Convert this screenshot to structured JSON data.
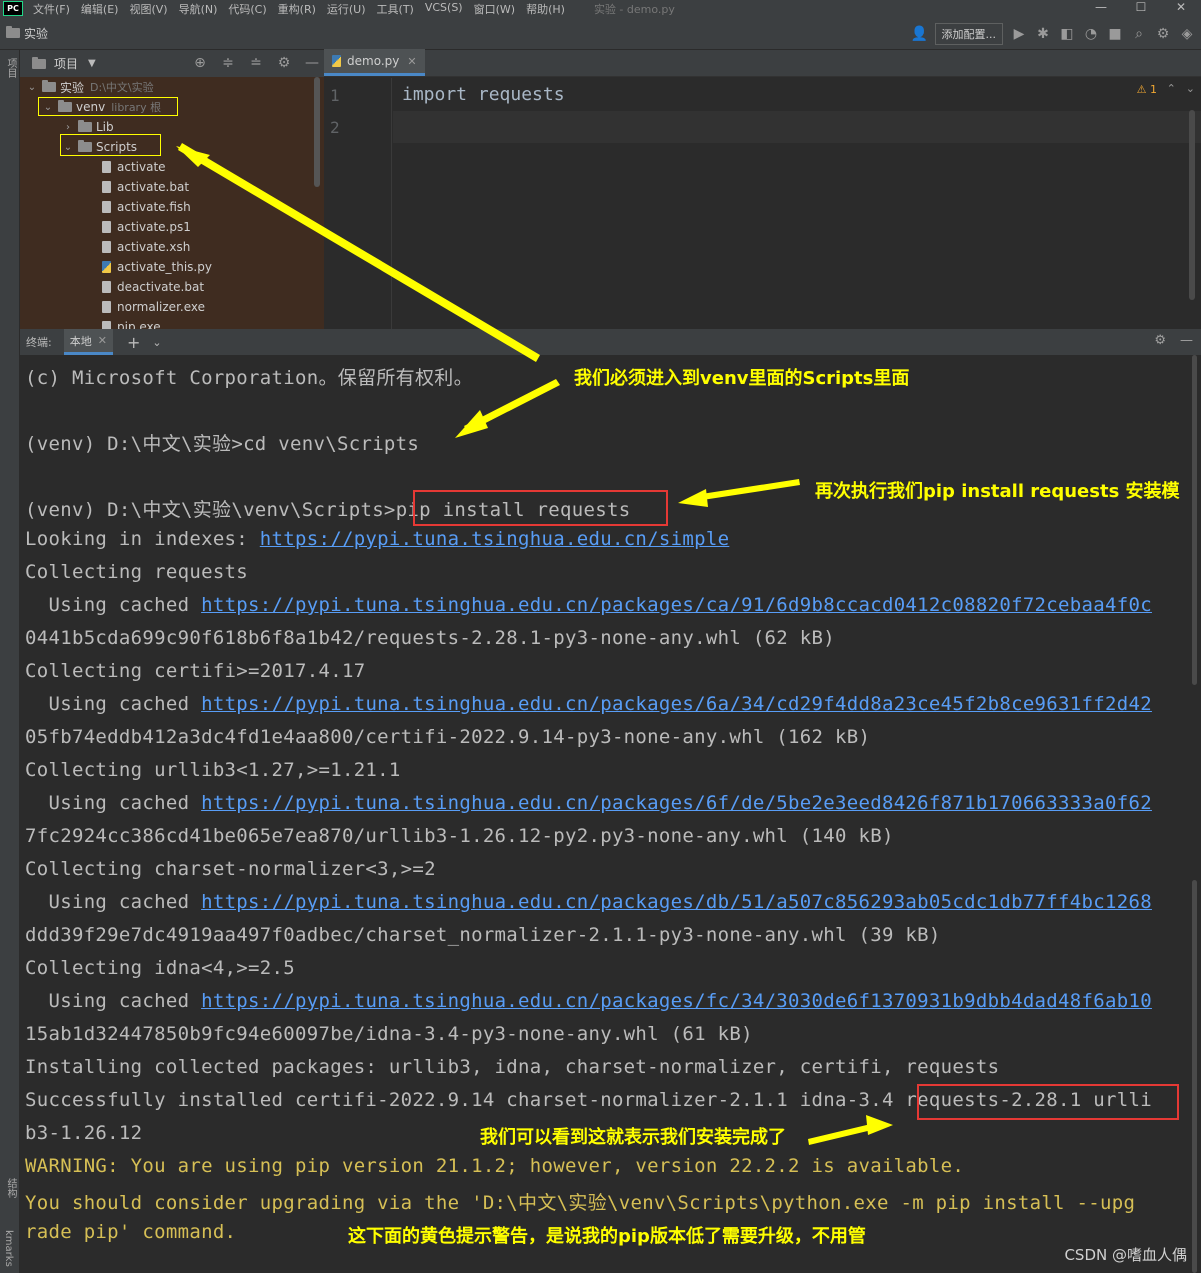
{
  "menubar": {
    "logo": "PC",
    "items": [
      "文件(F)",
      "编辑(E)",
      "视图(V)",
      "导航(N)",
      "代码(C)",
      "重构(R)",
      "运行(U)",
      "工具(T)",
      "VCS(S)",
      "窗口(W)",
      "帮助(H)"
    ],
    "window_title": "实验 - demo.py"
  },
  "toolbar": {
    "project_name": "实验",
    "add_config_label": "添加配置..."
  },
  "left_strip": {
    "project_label": "项目",
    "structure_label": "结构",
    "bookmarks_label": "kmarks"
  },
  "project_panel": {
    "title": "项目",
    "root": {
      "name": "实验",
      "path": "D:\\中文\\实验"
    },
    "venv": {
      "name": "venv",
      "hint": "library 根"
    },
    "lib": "Lib",
    "scripts": "Scripts",
    "files": [
      "activate",
      "activate.bat",
      "activate.fish",
      "activate.ps1",
      "activate.xsh",
      "activate_this.py",
      "deactivate.bat",
      "normalizer.exe",
      "pip.exe"
    ]
  },
  "editor": {
    "tab": "demo.py",
    "lines": [
      {
        "num": "1",
        "code": "import requests"
      },
      {
        "num": "2",
        "code": ""
      }
    ],
    "warning_count": "1"
  },
  "terminal": {
    "label": "终端:",
    "tab": "本地",
    "lines": {
      "l1": "(c) Microsoft Corporation。保留所有权利。",
      "l2": "(venv) D:\\中文\\实验>cd venv\\Scripts",
      "l3_prompt": "(venv) D:\\中文\\实验\\venv\\Scripts>",
      "l3_cmd": "pip install requests",
      "l4_text": "Looking in indexes: ",
      "l4_link": "https://pypi.tuna.tsinghua.edu.cn/simple",
      "l5": "Collecting requests",
      "l6_text": "  Using cached ",
      "l6_link": "https://pypi.tuna.tsinghua.edu.cn/packages/ca/91/6d9b8ccacd0412c08820f72cebaa4f0c",
      "l7": "0441b5cda699c90f618b6f8a1b42/requests-2.28.1-py3-none-any.whl (62 kB)",
      "l8": "Collecting certifi>=2017.4.17",
      "l9_text": "  Using cached ",
      "l9_link": "https://pypi.tuna.tsinghua.edu.cn/packages/6a/34/cd29f4dd8a23ce45f2b8ce9631ff2d42",
      "l10": "05fb74eddb412a3dc4fd1e4aa800/certifi-2022.9.14-py3-none-any.whl (162 kB)",
      "l11": "Collecting urllib3<1.27,>=1.21.1",
      "l12_text": "  Using cached ",
      "l12_link": "https://pypi.tuna.tsinghua.edu.cn/packages/6f/de/5be2e3eed8426f871b170663333a0f62",
      "l13": "7fc2924cc386cd41be065e7ea870/urllib3-1.26.12-py2.py3-none-any.whl (140 kB)",
      "l14": "Collecting charset-normalizer<3,>=2",
      "l15_text": "  Using cached ",
      "l15_link": "https://pypi.tuna.tsinghua.edu.cn/packages/db/51/a507c856293ab05cdc1db77ff4bc1268",
      "l16": "ddd39f29e7dc4919aa497f0adbec/charset_normalizer-2.1.1-py3-none-any.whl (39 kB)",
      "l17": "Collecting idna<4,>=2.5",
      "l18_text": "  Using cached ",
      "l18_link": "https://pypi.tuna.tsinghua.edu.cn/packages/fc/34/3030de6f1370931b9dbb4dad48f6ab10",
      "l19": "15ab1d32447850b9fc94e60097be/idna-3.4-py3-none-any.whl (61 kB)",
      "l20": "Installing collected packages: urllib3, idna, charset-normalizer, certifi, requests",
      "l21": "Successfully installed certifi-2022.9.14 charset-normalizer-2.1.1 idna-3.4 requests-2.28.1 urlli",
      "l22": "b3-1.26.12",
      "l23": "WARNING: You are using pip version 21.1.2; however, version 22.2.2 is available.",
      "l24": "You should consider upgrading via the 'D:\\中文\\实验\\venv\\Scripts\\python.exe -m pip install --upg",
      "l25": "rade pip' command."
    }
  },
  "annotations": {
    "a1": "我们必须进入到venv里面的Scripts里面",
    "a2": "再次执行我们pip install requests 安装模",
    "a3": "我们可以看到这就表示我们安装完成了",
    "a4": "这下面的黄色提示警告，是说我的pip版本低了需要升级，不用管"
  },
  "watermark": "CSDN @嗜血人偶",
  "colors": {
    "link": "#589df6",
    "warning": "#d6bf55",
    "annotation": "#ffff00",
    "redbox": "#e53935"
  }
}
